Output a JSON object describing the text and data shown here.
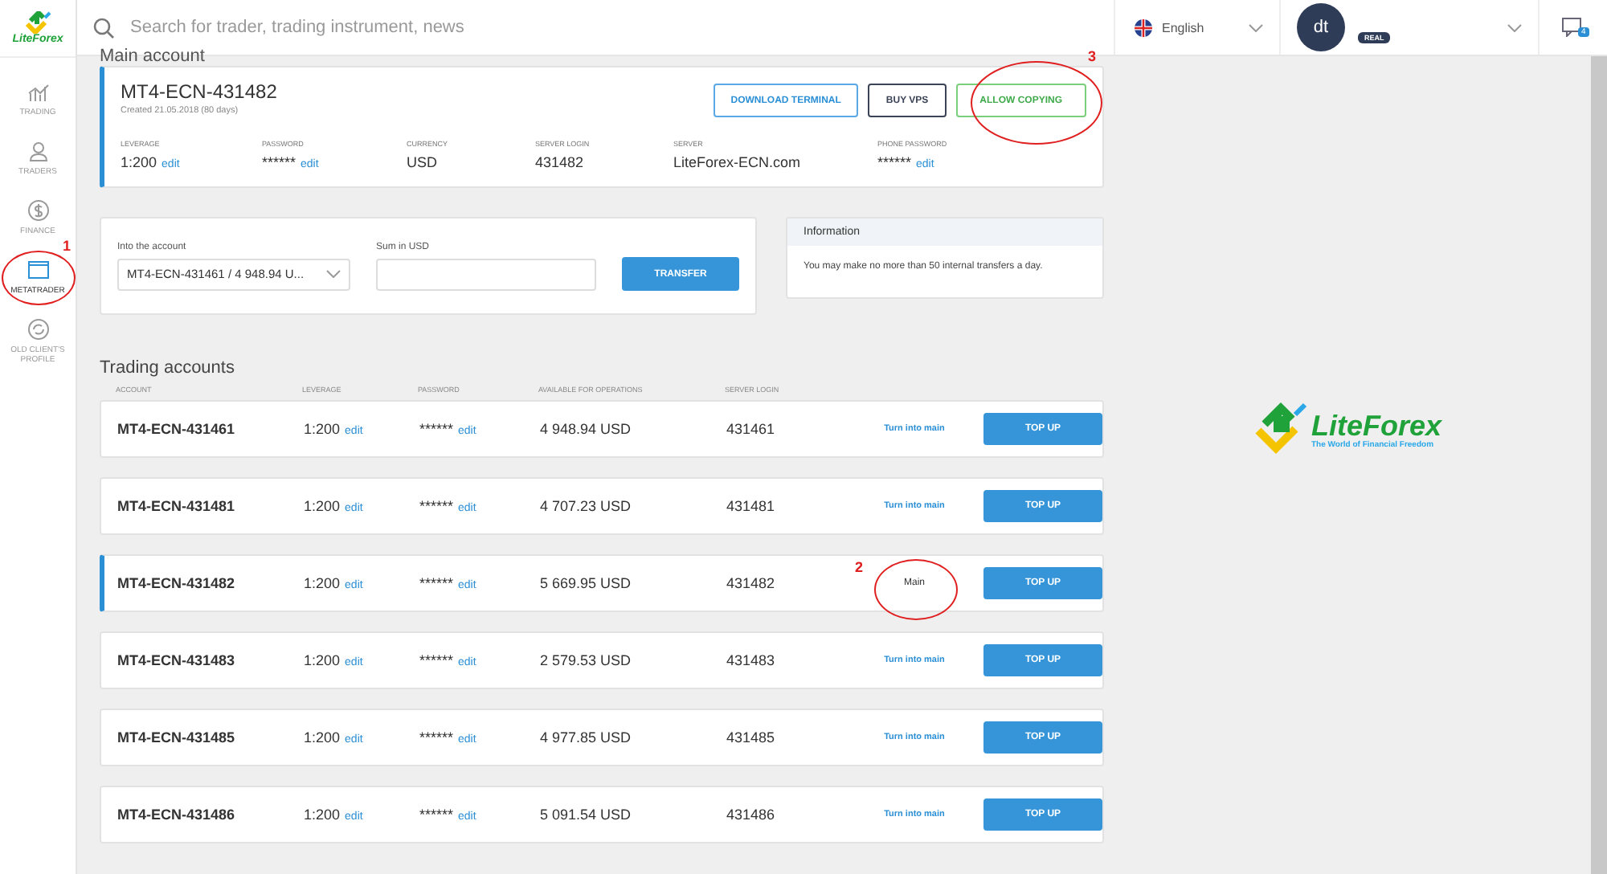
{
  "logo": {
    "text": "LiteForex"
  },
  "search": {
    "placeholder": "Search for trader, trading instrument, news"
  },
  "language": {
    "label": "English"
  },
  "user": {
    "initials": "dt",
    "badge": "REAL"
  },
  "messages": {
    "count": "4"
  },
  "sidebar": {
    "items": [
      {
        "label": "TRADING",
        "selected": false
      },
      {
        "label": "TRADERS",
        "selected": false
      },
      {
        "label": "FINANCE",
        "selected": false
      },
      {
        "label": "METATRADER",
        "selected": true
      },
      {
        "label": "OLD CLIENT'S PROFILE",
        "selected": false
      }
    ]
  },
  "main_account": {
    "heading": "Main account",
    "name": "MT4-ECN-431482",
    "created": "Created 21.05.2018 (80 days)",
    "buttons": [
      {
        "label": "DOWNLOAD TERMINAL",
        "kind": "outline"
      },
      {
        "label": "BUY VPS",
        "kind": "dark"
      },
      {
        "label": "ALLOW COPYING",
        "kind": "green"
      }
    ],
    "fields": [
      {
        "label": "LEVERAGE",
        "value": "1:200",
        "link": "edit"
      },
      {
        "label": "PASSWORD",
        "value": "******",
        "link": "edit"
      },
      {
        "label": "CURRENCY",
        "value": "USD"
      },
      {
        "label": "SERVER LOGIN",
        "value": "431482"
      },
      {
        "label": "SERVER",
        "value": "LiteForex-ECN.com"
      },
      {
        "label": "PHONE PASSWORD",
        "value": "******",
        "link": "edit"
      }
    ]
  },
  "transfer": {
    "account_label": "Into the account",
    "account_value": "MT4-ECN-431461 / 4 948.94 U...",
    "sum_label": "Sum in USD",
    "button": "TRANSFER"
  },
  "information": {
    "title": "Information",
    "text": "You may make no more than 50 internal transfers a day."
  },
  "trading_accounts": {
    "heading": "Trading accounts",
    "columns": [
      "ACCOUNT",
      "LEVERAGE",
      "PASSWORD",
      "AVAILABLE FOR OPERATIONS",
      "SERVER LOGIN"
    ],
    "rows": [
      {
        "account": "MT4-ECN-431461",
        "leverage": "1:200",
        "leverage_link": "edit",
        "password": "******",
        "password_link": "edit",
        "available": "4 948.94 USD",
        "login": "431461",
        "status": "Turn into main",
        "main": false,
        "button": "TOP UP"
      },
      {
        "account": "MT4-ECN-431481",
        "leverage": "1:200",
        "leverage_link": "edit",
        "password": "******",
        "password_link": "edit",
        "available": "4 707.23 USD",
        "login": "431481",
        "status": "Turn into main",
        "main": false,
        "button": "TOP UP"
      },
      {
        "account": "MT4-ECN-431482",
        "leverage": "1:200",
        "leverage_link": "edit",
        "password": "******",
        "password_link": "edit",
        "available": "5 669.95 USD",
        "login": "431482",
        "status": "Main",
        "main": true,
        "button": "TOP UP"
      },
      {
        "account": "MT4-ECN-431483",
        "leverage": "1:200",
        "leverage_link": "edit",
        "password": "******",
        "password_link": "edit",
        "available": "2 579.53 USD",
        "login": "431483",
        "status": "Turn into main",
        "main": false,
        "button": "TOP UP"
      },
      {
        "account": "MT4-ECN-431485",
        "leverage": "1:200",
        "leverage_link": "edit",
        "password": "******",
        "password_link": "edit",
        "available": "4 977.85 USD",
        "login": "431485",
        "status": "Turn into main",
        "main": false,
        "button": "TOP UP"
      },
      {
        "account": "MT4-ECN-431486",
        "leverage": "1:200",
        "leverage_link": "edit",
        "password": "******",
        "password_link": "edit",
        "available": "5 091.54 USD",
        "login": "431486",
        "status": "Turn into main",
        "main": false,
        "button": "TOP UP"
      }
    ]
  },
  "brand_logo": {
    "name": "LiteForex",
    "tagline": "The World of Financial Freedom"
  },
  "annotations": [
    {
      "label": "1"
    },
    {
      "label": "2"
    },
    {
      "label": "3"
    }
  ]
}
